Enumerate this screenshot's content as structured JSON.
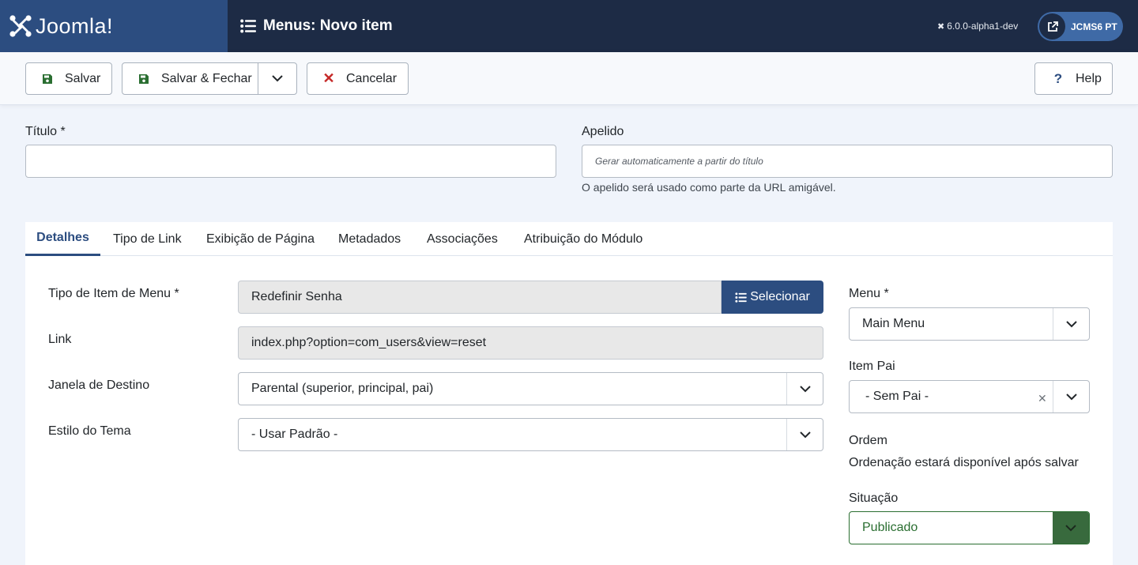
{
  "header": {
    "logo_text": "Joomla!",
    "page_title": "Menus: Novo item",
    "version": "6.0.0-alpha1-dev",
    "site_button_label": "JCMS6 PT"
  },
  "toolbar": {
    "save_label": "Salvar",
    "save_close_label": "Salvar & Fechar",
    "cancel_label": "Cancelar",
    "help_label": "Help"
  },
  "form": {
    "title_label": "Título *",
    "title_value": "",
    "alias_label": "Apelido",
    "alias_placeholder": "Gerar automaticamente a partir do título",
    "alias_hint": "O apelido será usado como parte da URL amigável."
  },
  "tabs": [
    {
      "label": "Detalhes",
      "active": true
    },
    {
      "label": "Tipo de Link",
      "active": false
    },
    {
      "label": "Exibição de Página",
      "active": false
    },
    {
      "label": "Metadados",
      "active": false
    },
    {
      "label": "Associações",
      "active": false
    },
    {
      "label": "Atribuição do Módulo",
      "active": false
    }
  ],
  "details": {
    "menu_item_type_label": "Tipo de Item de Menu *",
    "menu_item_type_value": "Redefinir Senha",
    "select_button_label": "Selecionar",
    "link_label": "Link",
    "link_value": "index.php?option=com_users&view=reset",
    "target_window_label": "Janela de Destino",
    "target_window_value": "Parental (superior, principal, pai)",
    "template_style_label": "Estilo do Tema",
    "template_style_value": "- Usar Padrão -"
  },
  "sidebar": {
    "menu_label": "Menu *",
    "menu_value": "Main Menu",
    "parent_label": "Item Pai",
    "parent_value": "- Sem Pai -",
    "ordering_label": "Ordem",
    "ordering_text": "Ordenação estará disponível após salvar",
    "status_label": "Situação",
    "status_value": "Publicado"
  },
  "colors": {
    "header_bg": "#1d2b45",
    "logo_bg": "#2c4d80",
    "accent": "#2c4d80",
    "cancel_red": "#c52827",
    "status_green": "#2a6e31"
  }
}
